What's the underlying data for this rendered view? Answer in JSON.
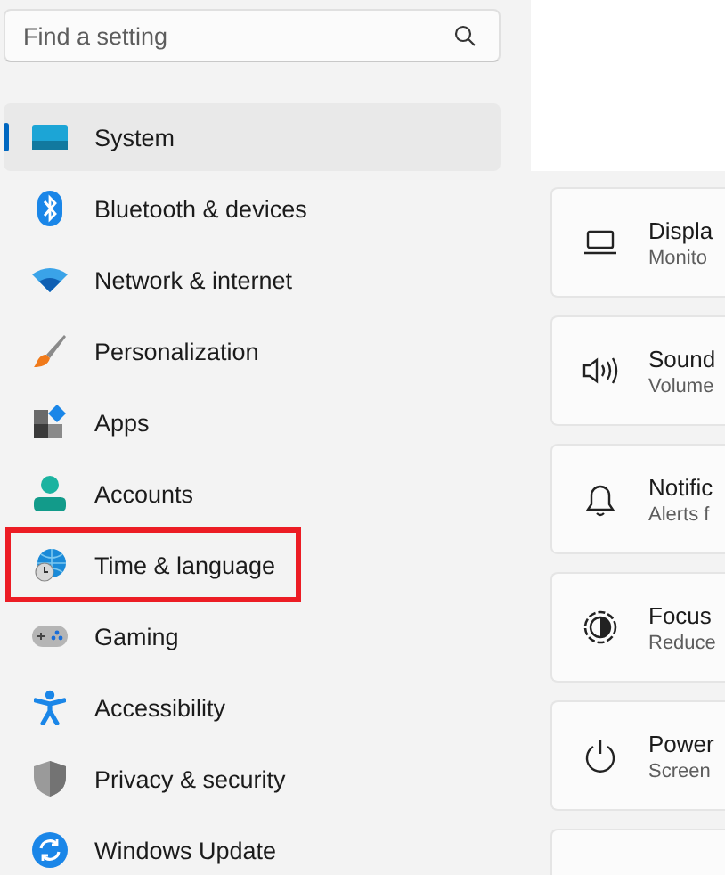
{
  "search": {
    "placeholder": "Find a setting"
  },
  "nav": [
    {
      "label": "System",
      "kind": "system",
      "selected": true,
      "highlighted": false
    },
    {
      "label": "Bluetooth & devices",
      "kind": "bluetooth",
      "selected": false,
      "highlighted": false
    },
    {
      "label": "Network & internet",
      "kind": "network",
      "selected": false,
      "highlighted": false
    },
    {
      "label": "Personalization",
      "kind": "brush",
      "selected": false,
      "highlighted": false
    },
    {
      "label": "Apps",
      "kind": "apps",
      "selected": false,
      "highlighted": false
    },
    {
      "label": "Accounts",
      "kind": "person",
      "selected": false,
      "highlighted": false
    },
    {
      "label": "Time & language",
      "kind": "globe",
      "selected": false,
      "highlighted": true
    },
    {
      "label": "Gaming",
      "kind": "gamepad",
      "selected": false,
      "highlighted": false
    },
    {
      "label": "Accessibility",
      "kind": "accessibility",
      "selected": false,
      "highlighted": false
    },
    {
      "label": "Privacy & security",
      "kind": "shield",
      "selected": false,
      "highlighted": false
    },
    {
      "label": "Windows Update",
      "kind": "update",
      "selected": false,
      "highlighted": false
    }
  ],
  "cards": [
    {
      "kind": "laptop",
      "title": "Displa",
      "subtitle": "Monito"
    },
    {
      "kind": "speaker",
      "title": "Sound",
      "subtitle": "Volume"
    },
    {
      "kind": "bell",
      "title": "Notific",
      "subtitle": "Alerts f"
    },
    {
      "kind": "focus",
      "title": "Focus",
      "subtitle": "Reduce"
    },
    {
      "kind": "power",
      "title": "Power",
      "subtitle": "Screen"
    },
    {
      "kind": "blank"
    }
  ]
}
